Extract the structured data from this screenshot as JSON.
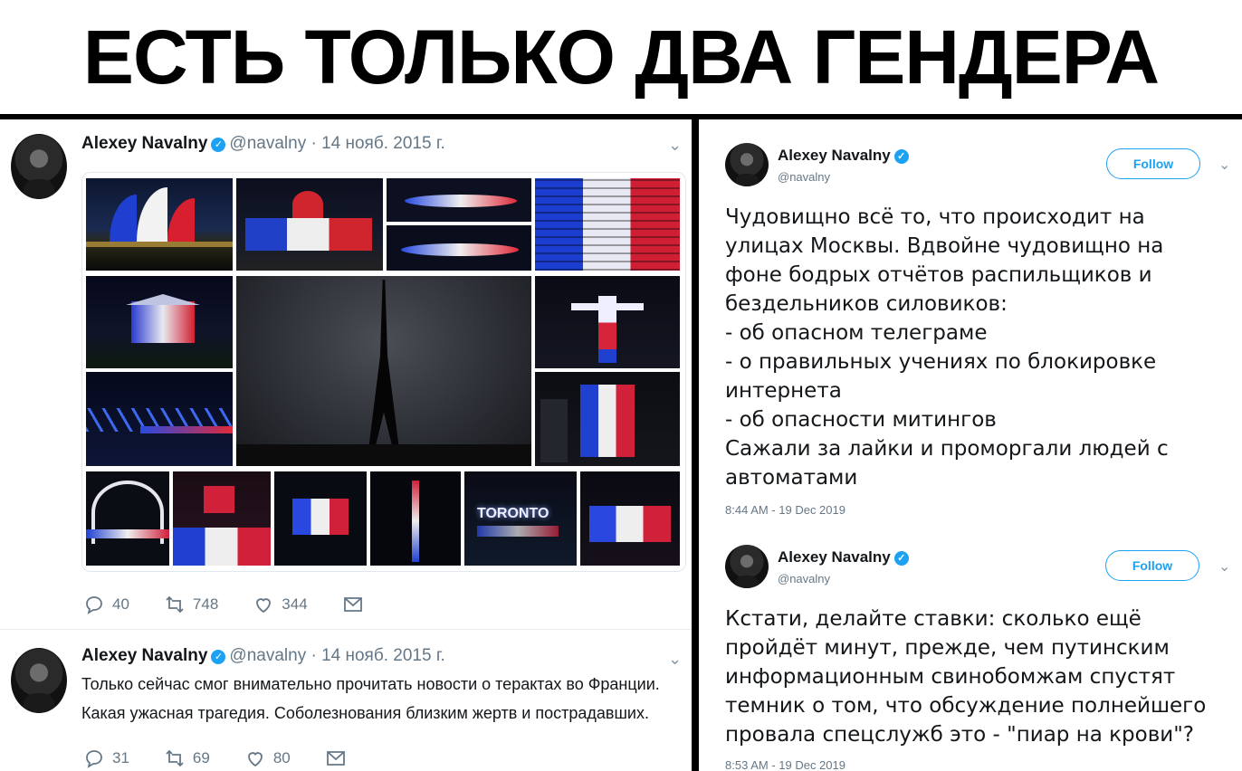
{
  "meme_title": "ЕСТЬ ТОЛЬКО ДВА ГЕНДЕРА",
  "left": {
    "tweet1": {
      "name": "Alexey Navalny",
      "handle_date": "@navalny · 14 нояб. 2015 г.",
      "replies": "40",
      "retweets": "748",
      "likes": "344"
    },
    "tweet2": {
      "name": "Alexey Navalny",
      "handle_date": "@navalny · 14 нояб. 2015 г.",
      "text_line1": "Только сейчас смог внимательно прочитать новости о терактах во Франции.",
      "text_line2": "Какая ужасная трагедия. Соболезнования близким жертв и пострадавших.",
      "replies": "31",
      "retweets": "69",
      "likes": "80"
    }
  },
  "right": {
    "tweet1": {
      "name": "Alexey Navalny",
      "handle": "@navalny",
      "follow_label": "Follow",
      "text": "Чудовищно всё то, что происходит на\nулицах Москвы. Вдвойне чудовищно на\nфоне бодрых отчётов распильщиков и\nбездельников силовиков:\n- об опасном телеграме\n- о правильных учениях по блокировке\nинтернета\n- об опасности митингов\nСажали за лайки и проморгали людей с\nавтоматами",
      "timestamp": "8:44 AM - 19 Dec 2019"
    },
    "tweet2": {
      "name": "Alexey Navalny",
      "handle": "@navalny",
      "follow_label": "Follow",
      "text": "Кстати, делайте ставки: сколько ещё\nпройдёт минут, прежде, чем путинским\nинформационным свинобомжам спустят\nтемник о том, что обсуждение полнейшего\nпровала спецслужб это - \"пиар на крови\"?",
      "timestamp": "8:53 AM - 19 Dec 2019"
    }
  },
  "collage_sign_text": "TORONTO",
  "colors": {
    "twitter_blue": "#1da1f2",
    "flag_blue": "#1f3fb5",
    "flag_red": "#d11a2a"
  }
}
